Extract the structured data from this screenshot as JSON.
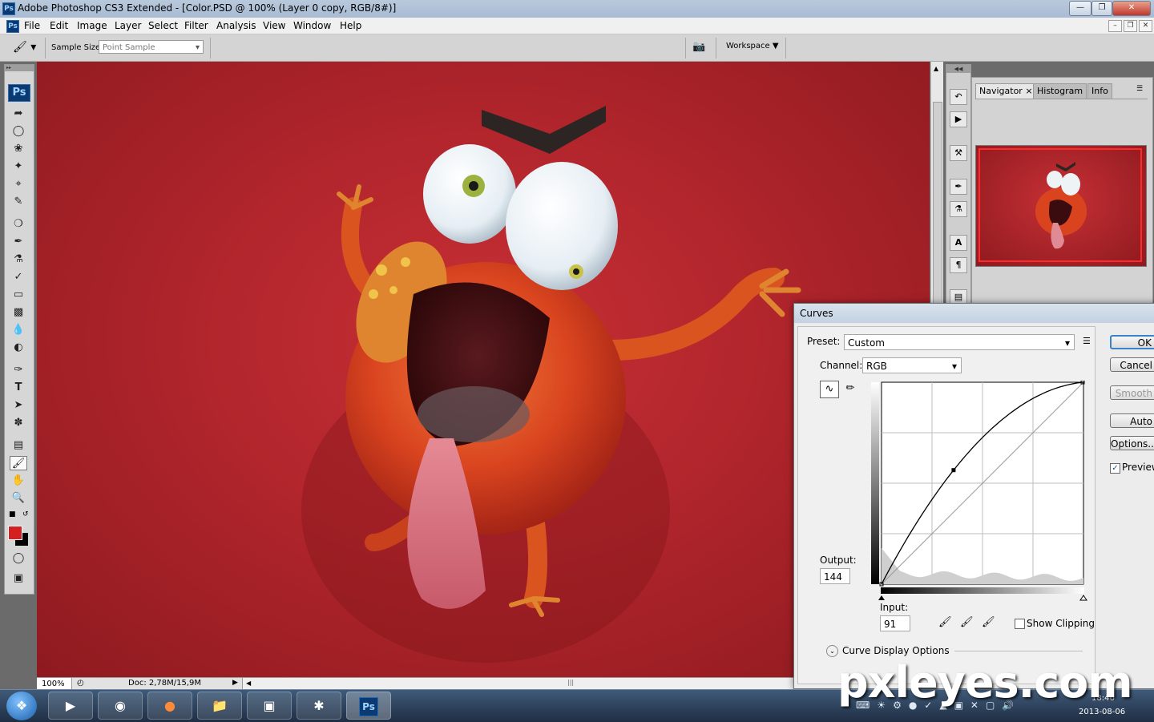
{
  "app": {
    "title": "Adobe Photoshop CS3 Extended - [Color.PSD @ 100% (Layer 0 copy, RGB/8#)]",
    "logo": "Ps"
  },
  "menu": [
    "File",
    "Edit",
    "Image",
    "Layer",
    "Select",
    "Filter",
    "Analysis",
    "View",
    "Window",
    "Help"
  ],
  "options_bar": {
    "sample_size_label": "Sample Size:",
    "sample_size_value": "Point Sample",
    "workspace_label": "Workspace"
  },
  "tools": [
    "move",
    "marquee",
    "lasso",
    "magic-wand",
    "crop",
    "slice",
    "healing",
    "brush",
    "stamp",
    "history-brush",
    "eraser",
    "gradient",
    "blur",
    "dodge",
    "pen",
    "type",
    "path-select",
    "shape",
    "notes",
    "eyedropper",
    "hand",
    "zoom"
  ],
  "colors": {
    "foreground": "#d42020",
    "background": "#000000",
    "canvas": "#b1252c"
  },
  "status": {
    "zoom": "100%",
    "doc": "Doc: 2,78M/15,9M"
  },
  "navigator": {
    "tabs": [
      "Navigator",
      "Histogram",
      "Info"
    ],
    "active_tab": "Navigator"
  },
  "curves": {
    "title": "Curves",
    "preset_label": "Preset:",
    "preset_value": "Custom",
    "channel_label": "Channel:",
    "channel_value": "RGB",
    "output_label": "Output:",
    "output_value": "144",
    "input_label": "Input:",
    "input_value": "91",
    "show_clipping_label": "Show Clipping",
    "curve_display_options": "Curve Display Options",
    "buttons": {
      "ok": "OK",
      "cancel": "Cancel",
      "smooth": "Smooth",
      "auto": "Auto",
      "options": "Options..."
    },
    "preview_label": "Preview",
    "preview_checked": true,
    "point": {
      "input": 91,
      "output": 144
    }
  },
  "taskbar": {
    "time": "18:46",
    "date": "2013-08-06"
  },
  "watermark": "pxleyes.com"
}
